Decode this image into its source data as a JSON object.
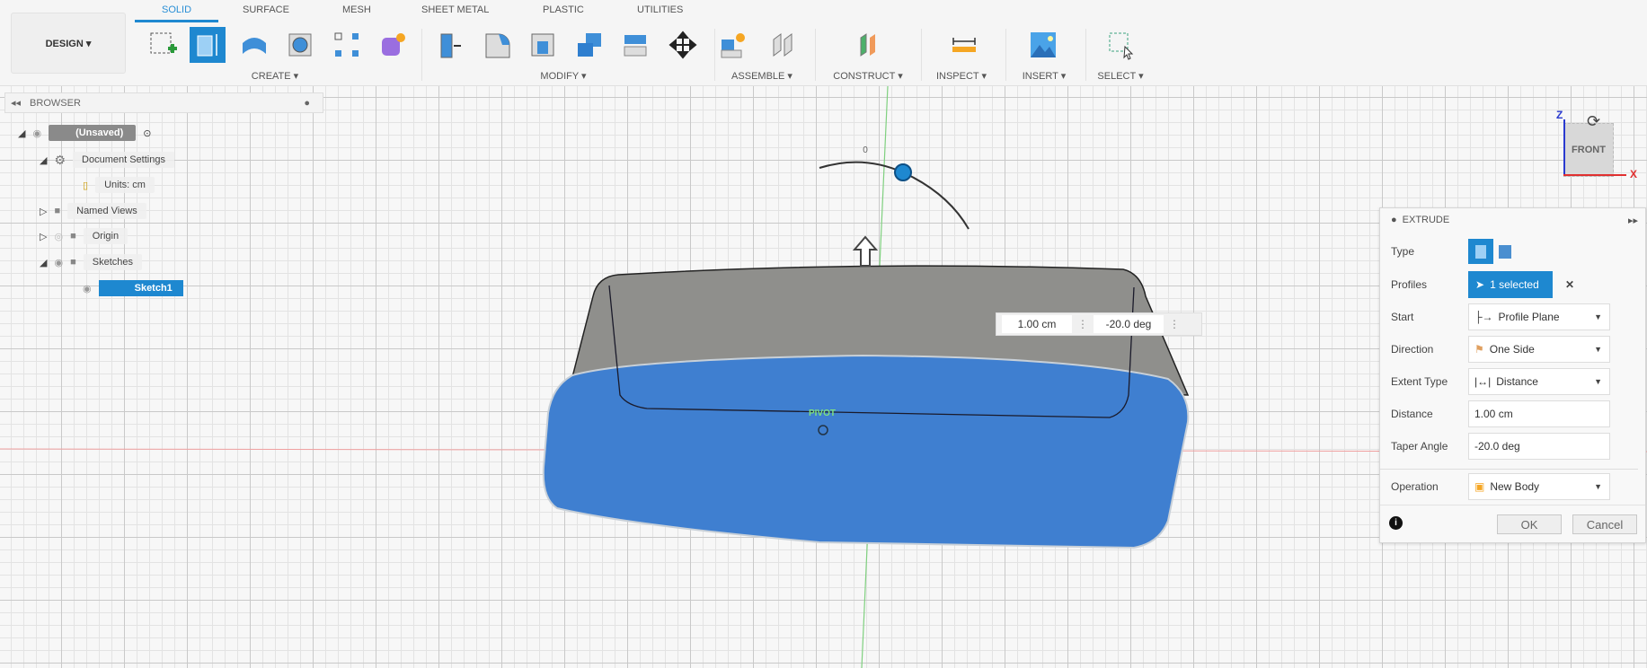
{
  "toolbar": {
    "workspace": "DESIGN ▾",
    "tabs": [
      "SOLID",
      "SURFACE",
      "MESH",
      "SHEET METAL",
      "PLASTIC",
      "UTILITIES"
    ],
    "groups": {
      "create": "CREATE ▾",
      "modify": "MODIFY ▾",
      "assemble": "ASSEMBLE ▾",
      "construct": "CONSTRUCT ▾",
      "inspect": "INSPECT ▾",
      "insert": "INSERT ▾",
      "select": "SELECT ▾"
    }
  },
  "browser": {
    "title": "BROWSER",
    "items": [
      {
        "label": "(Unsaved)"
      },
      {
        "label": "Document Settings"
      },
      {
        "label": "Units: cm"
      },
      {
        "label": "Named Views"
      },
      {
        "label": "Origin"
      },
      {
        "label": "Sketches"
      },
      {
        "label": "Sketch1"
      }
    ]
  },
  "viewcube": {
    "face": "FRONT",
    "axis_z": "Z",
    "axis_x": "X"
  },
  "canvas": {
    "angle_zero": "0",
    "pivot": "PIVOT",
    "distance_input": "1.00 cm",
    "angle_input": "-20.0 deg"
  },
  "extrude": {
    "title": "EXTRUDE",
    "type_label": "Type",
    "profiles_label": "Profiles",
    "profiles_value": "1 selected",
    "start_label": "Start",
    "start_value": "Profile Plane",
    "direction_label": "Direction",
    "direction_value": "One Side",
    "extent_label": "Extent Type",
    "extent_value": "Distance",
    "distance_label": "Distance",
    "distance_value": "1.00 cm",
    "taper_label": "Taper Angle",
    "taper_value": "-20.0 deg",
    "operation_label": "Operation",
    "operation_value": "New Body",
    "ok": "OK",
    "cancel": "Cancel"
  },
  "colors": {
    "accent": "#1e88d0",
    "body_blue": "#3f7fd0",
    "body_grey": "#8f8f8c"
  }
}
